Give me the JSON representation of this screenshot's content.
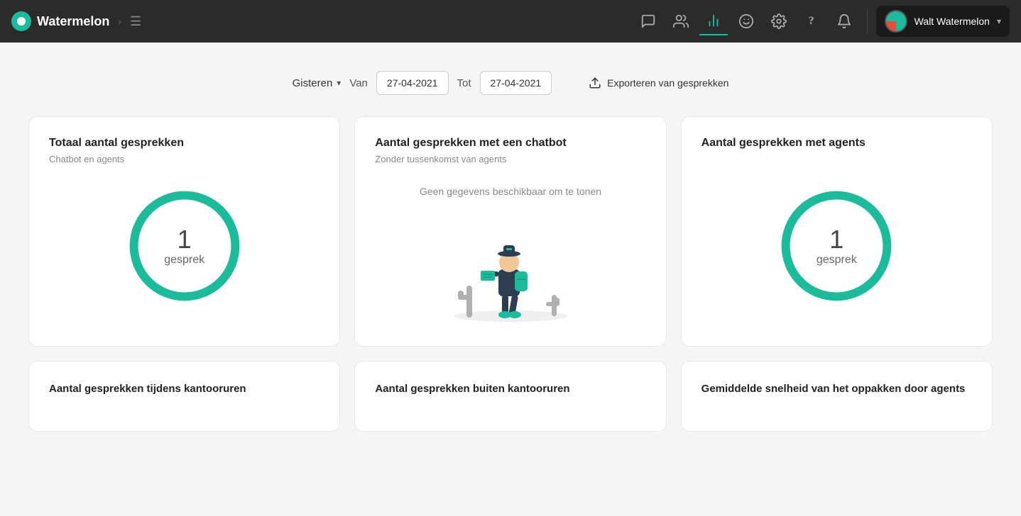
{
  "app": {
    "name": "Watermelon"
  },
  "navbar": {
    "logo_alt": "Watermelon logo",
    "user_name": "Walt Watermelon",
    "menu_icon": "☰",
    "arrow": "›",
    "chevron_down": "▾",
    "icons": {
      "chat": "💬",
      "people": "👥",
      "bar_chart": "📊",
      "emoji": "😊",
      "settings": "⚙",
      "help": "?",
      "bell": "🔔"
    }
  },
  "filter_bar": {
    "period_label": "Gisteren",
    "van_label": "Van",
    "tot_label": "Tot",
    "date_from": "27-04-2021",
    "date_to": "27-04-2021",
    "export_label": "Exporteren van gesprekken",
    "export_icon": "⬆"
  },
  "cards": {
    "total": {
      "title": "Totaal aantal gesprekken",
      "subtitle": "Chatbot en agents",
      "count": "1",
      "unit": "gesprek",
      "color": "#1abc9c"
    },
    "chatbot": {
      "title": "Aantal gesprekken met een chatbot",
      "subtitle": "Zonder tussenkomst van agents",
      "empty_text": "Geen gegevens beschikbaar om te tonen"
    },
    "agents": {
      "title": "Aantal gesprekken met agents",
      "count": "1",
      "unit": "gesprek",
      "color": "#1abc9c"
    }
  },
  "bottom_cards": {
    "kantoor": {
      "title": "Aantal gesprekken tijdens kantooruren"
    },
    "buiten_kantoor": {
      "title": "Aantal gesprekken buiten kantooruren"
    },
    "snelheid": {
      "title": "Gemiddelde snelheid van het oppakken door agents"
    }
  }
}
